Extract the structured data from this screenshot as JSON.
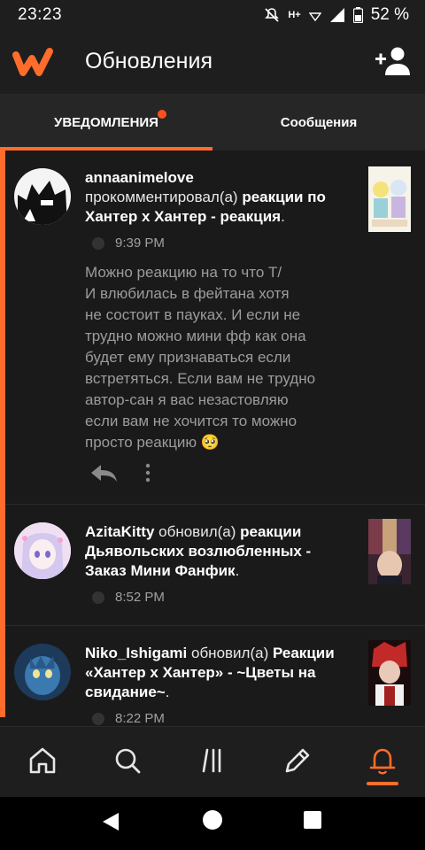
{
  "status_bar": {
    "time": "23:23",
    "network_label": "H+",
    "battery_percent": "52 %"
  },
  "header": {
    "title": "Обновления",
    "logo_icon": "wattpad-logo-icon",
    "action_icon": "add-user-icon"
  },
  "tabs": [
    {
      "label": "УВЕДОМЛЕНИЯ",
      "active": true,
      "has_dot": true
    },
    {
      "label": "Сообщения",
      "active": false,
      "has_dot": false
    }
  ],
  "notifications": [
    {
      "user": "annaanimelove",
      "action": " прокомментировал(а) ",
      "story": "реакции по Хантер х Хантер - реакция",
      "suffix": ".",
      "time": "9:39 PM",
      "comment": "Можно реакцию на то что Т/\nИ влюбилась в фейтана хотя\nне состоит в пауках. И если не\nтрудно можно мини фф как она\nбудет ему признаваться если\nвстретяться. Если вам не трудно\nавтор-сан я вас  незастовляю\nесли вам не хочится то можно\nпросто реакцию",
      "emoji": "🥺"
    },
    {
      "user": "AzitaKitty",
      "action": " обновил(а) ",
      "story": "реакции Дьявольских возлюбленных - Заказ Мини Фанфик",
      "suffix": ".",
      "time": "8:52 PM"
    },
    {
      "user": "Niko_Ishigami",
      "action": " обновил(а) ",
      "story": "Реакции «Хантер х Хантер» - ~Цветы на свидание~",
      "suffix": ".",
      "time": "8:22 PM"
    }
  ],
  "bottom_nav": [
    {
      "name": "home-icon"
    },
    {
      "name": "search-icon"
    },
    {
      "name": "library-icon"
    },
    {
      "name": "write-icon"
    },
    {
      "name": "notifications-icon",
      "active": true
    }
  ],
  "colors": {
    "accent": "#ff6c2c",
    "background": "#1a1a1a",
    "dot": "#ff4f1f"
  }
}
